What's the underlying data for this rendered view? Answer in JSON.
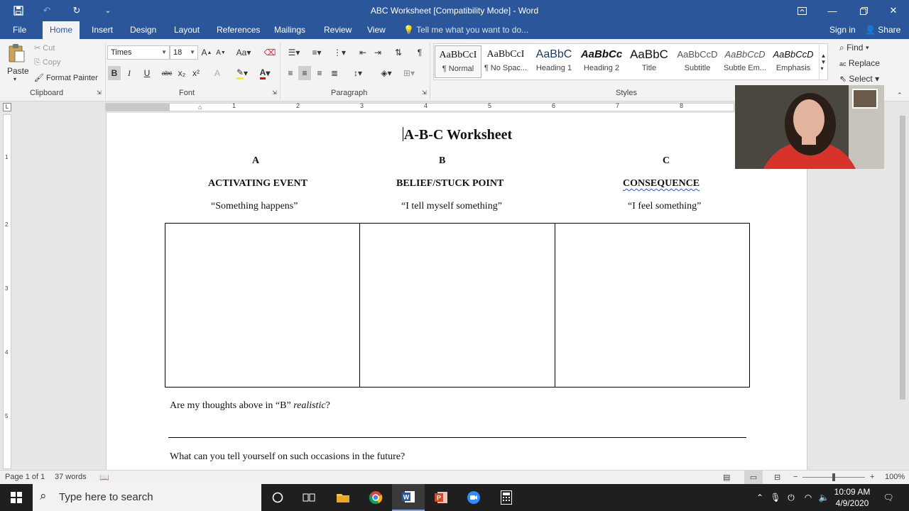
{
  "window": {
    "title": "ABC Worksheet [Compatibility Mode] - Word"
  },
  "tabs": [
    "File",
    "Home",
    "Insert",
    "Design",
    "Layout",
    "References",
    "Mailings",
    "Review",
    "View"
  ],
  "tell_me": "Tell me what you want to do...",
  "account": {
    "sign_in": "Sign in",
    "share": "Share"
  },
  "clipboard": {
    "paste": "Paste",
    "cut": "Cut",
    "copy": "Copy",
    "format_painter": "Format Painter",
    "label": "Clipboard"
  },
  "font": {
    "name": "Times",
    "size": "18",
    "label": "Font"
  },
  "paragraph": {
    "label": "Paragraph"
  },
  "styles": {
    "label": "Styles",
    "items": [
      {
        "preview": "AaBbCcI",
        "name": "¶ Normal"
      },
      {
        "preview": "AaBbCcI",
        "name": "¶ No Spac..."
      },
      {
        "preview": "AaBbC",
        "name": "Heading 1"
      },
      {
        "preview": "AaBbCc",
        "name": "Heading 2"
      },
      {
        "preview": "AaBbC",
        "name": "Title"
      },
      {
        "preview": "AaBbCcD",
        "name": "Subtitle"
      },
      {
        "preview": "AaBbCcD",
        "name": "Subtle Em..."
      },
      {
        "preview": "AaBbCcD",
        "name": "Emphasis"
      }
    ]
  },
  "editing": {
    "find": "Find",
    "replace": "Replace",
    "select": "Select"
  },
  "ruler": {
    "numbers": [
      "1",
      "2",
      "3",
      "4",
      "5",
      "6",
      "7",
      "8"
    ]
  },
  "vruler": {
    "numbers": [
      "1",
      "2",
      "3",
      "4",
      "5"
    ]
  },
  "document": {
    "title": "A-B-C Worksheet",
    "columns": [
      {
        "letter": "A",
        "heading": "ACTIVATING EVENT",
        "subtitle": "“Something happens”"
      },
      {
        "letter": "B",
        "heading": "BELIEF/STUCK POINT",
        "subtitle": "“I tell myself something”"
      },
      {
        "letter": "C",
        "heading": "CONSEQUENCE",
        "subtitle": "“I feel something”"
      }
    ],
    "question1_prefix": "Are my thoughts above in “B” ",
    "question1_italic": "realistic",
    "question1_suffix": "?",
    "question2": "What can you tell yourself on such occasions in the future?"
  },
  "status": {
    "page": "Page 1 of 1",
    "words": "37 words",
    "zoom": "100%"
  },
  "taskbar": {
    "search_placeholder": "Type here to search",
    "time": "10:09 AM",
    "date": "4/9/2020"
  },
  "colors": {
    "word_blue": "#2b579a",
    "ribbon_bg": "#f3f3f3",
    "taskbar": "#1f1f1f"
  }
}
